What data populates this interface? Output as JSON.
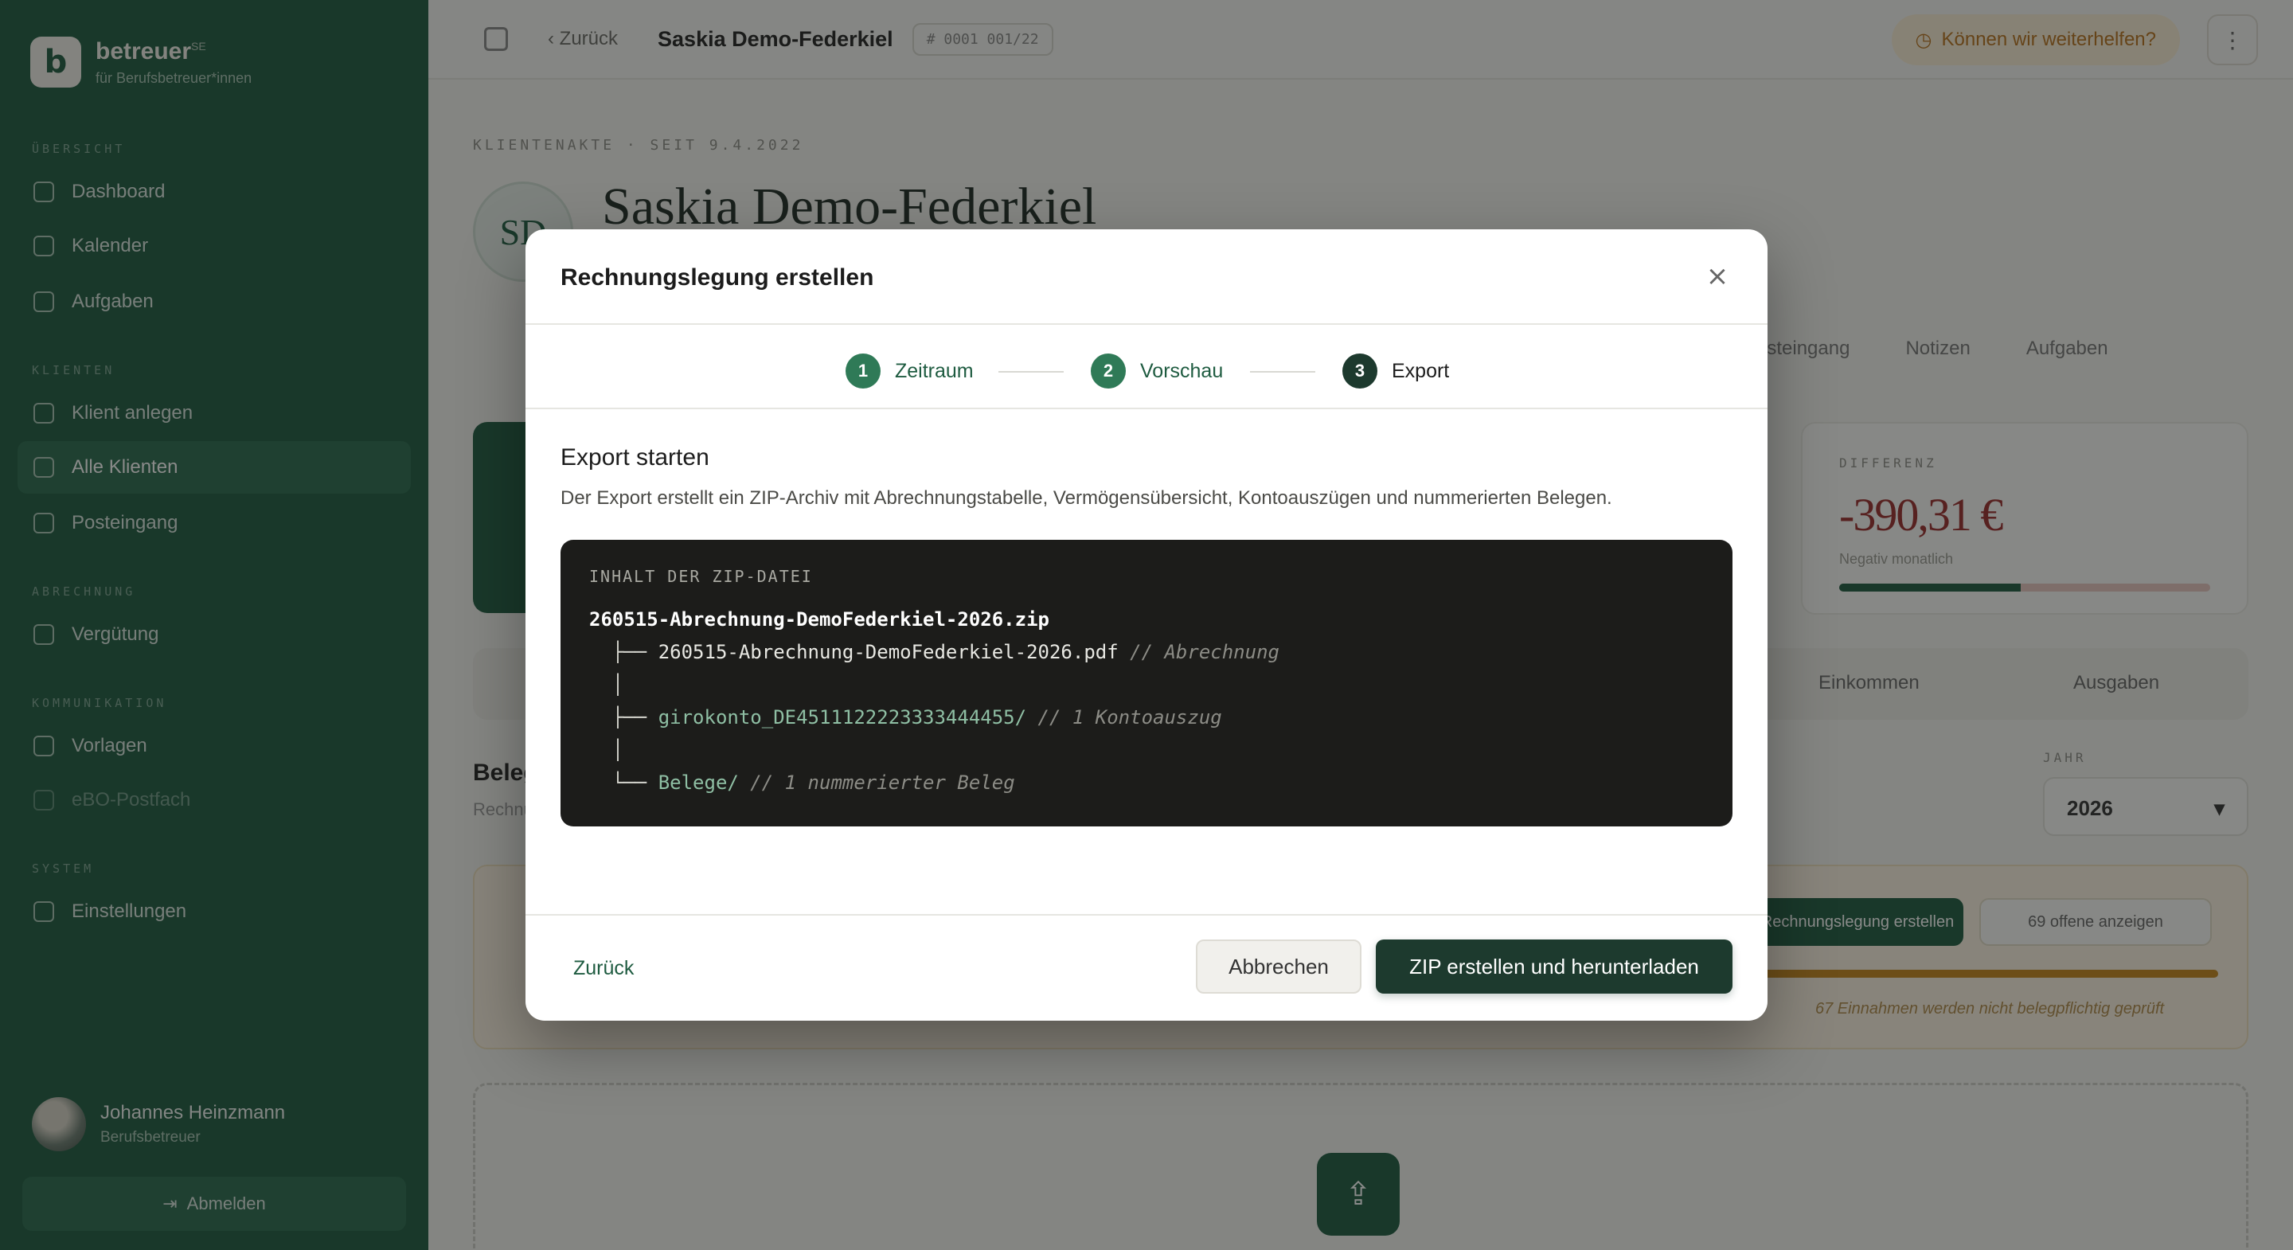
{
  "sidebar": {
    "brand_name": "betreuer",
    "brand_sup": "SE",
    "brand_sub": "für Berufsbetreuer*innen",
    "groups": {
      "overview": "Übersicht",
      "clients": "Klienten",
      "billing": "Abrechnung",
      "communication": "Kommunikation",
      "system": "System"
    },
    "items": {
      "dashboard": "Dashboard",
      "calendar": "Kalender",
      "tasks": "Aufgaben",
      "new_client": "Klient anlegen",
      "all_clients": "Alle Klienten",
      "inbox": "Posteingang",
      "compensation": "Vergütung",
      "templates": "Vorlagen",
      "efax": "eBO-Postfach",
      "settings": "Einstellungen"
    },
    "user_name": "Johannes Heinzmann",
    "user_role": "Berufsbetreuer",
    "logout_label": "Abmelden"
  },
  "topbar": {
    "back_label": "Zurück",
    "title": "Saskia Demo-Federkiel",
    "chip": "# 0001 001/22",
    "help_label": "Können wir weiterhelfen?",
    "menu_label": "⋮"
  },
  "client": {
    "eyebrow": "KLIENTENAKTE · SEIT 9.4.2022",
    "initials": "SD",
    "name": "Saskia Demo-Federkiel",
    "tabs": [
      "Posteingang",
      "Notizen",
      "Aufgaben"
    ]
  },
  "diff_card": {
    "label": "DIFFERENZ",
    "value": "-390,31 €",
    "sub": "Negativ monatlich",
    "progress": 0.49
  },
  "ledger": {
    "tabs": [
      "Einkommen",
      "Ausgaben"
    ],
    "title": "Belege",
    "subtitle": "Rechnungslegung",
    "year_label": "JAHR",
    "year_value": "2026",
    "action_primary": "Rechnungslegung erstellen",
    "action_secondary": "69 offene anzeigen",
    "note": "67 Einnahmen werden nicht belegpflichtig geprüft"
  },
  "modal": {
    "title": "Rechnungslegung erstellen",
    "close_label": "×",
    "steps": [
      {
        "number": "1",
        "label": "Zeitraum"
      },
      {
        "number": "2",
        "label": "Vorschau"
      },
      {
        "number": "3",
        "label": "Export"
      }
    ],
    "section_title": "Export starten",
    "section_desc": "Der Export erstellt ein ZIP-Archiv mit Abrechnungstabelle, Vermögensübersicht, Kontoauszügen und nummerierten Belegen.",
    "zip": {
      "heading": "INHALT DER ZIP-DATEI",
      "root": "260515-Abrechnung-DemoFederkiel-2026.zip",
      "entries": [
        {
          "prefix": "  ├── ",
          "name": "260515-Abrechnung-DemoFederkiel-2026.pdf",
          "comment": " // Abrechnung"
        },
        {
          "prefix": "  │",
          "name": "",
          "comment": ""
        },
        {
          "prefix": "  ├── ",
          "name": "girokonto_DE4511122223333444455/",
          "comment": " // 1 Kontoauszug"
        },
        {
          "prefix": "  │",
          "name": "",
          "comment": ""
        },
        {
          "prefix": "  └── ",
          "name": "Belege/",
          "comment": " // 1 nummerierter Beleg"
        }
      ]
    },
    "back_label": "Zurück",
    "cancel_label": "Abbrechen",
    "primary_label": "ZIP erstellen und herunterladen"
  },
  "colors": {
    "brand_green": "#1e5b40",
    "dark_green": "#1d3a2e",
    "negative_red": "#9b2d2d",
    "warning_orange": "#c7861c"
  }
}
